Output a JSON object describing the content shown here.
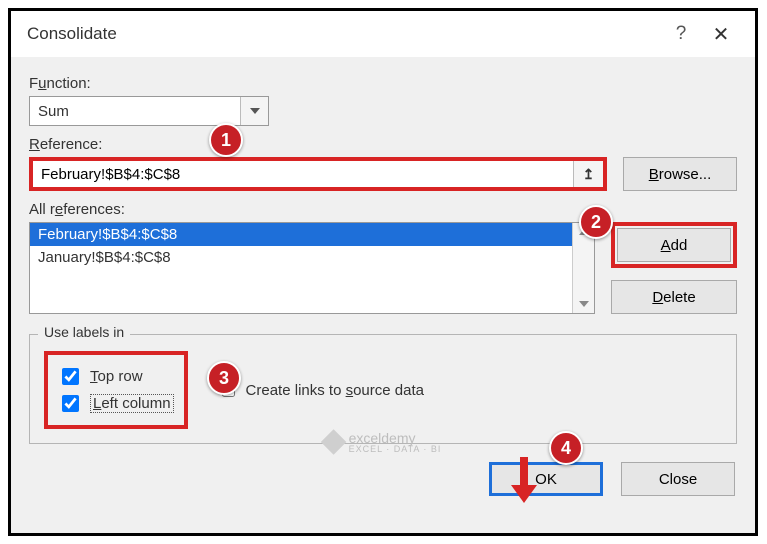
{
  "dialog": {
    "title": "Consolidate",
    "help": "?",
    "close": "✕"
  },
  "function": {
    "label_pre": "F",
    "label_u": "u",
    "label_post": "nction:",
    "value": "Sum"
  },
  "reference": {
    "label_u": "R",
    "label_post": "eference:",
    "value": "February!$B$4:$C$8",
    "browse_u": "B",
    "browse_post": "rowse..."
  },
  "all_refs": {
    "label_pre": "All r",
    "label_u": "e",
    "label_post": "ferences:",
    "items": [
      {
        "text": "February!$B$4:$C$8",
        "selected": true
      },
      {
        "text": "January!$B$4:$C$8",
        "selected": false
      }
    ],
    "add_u": "A",
    "add_post": "dd",
    "delete_u": "D",
    "delete_post": "elete"
  },
  "labels": {
    "legend": "Use labels in",
    "top_u": "T",
    "top_post": "op row",
    "left_u": "L",
    "left_post": "eft column",
    "links_pre": "Create links to ",
    "links_u": "s",
    "links_post": "ource data"
  },
  "footer": {
    "ok": "OK",
    "close": "Close"
  },
  "callouts": {
    "one": "1",
    "two": "2",
    "three": "3",
    "four": "4"
  },
  "watermark": {
    "name": "exceldemy",
    "sub": "EXCEL · DATA · BI"
  }
}
